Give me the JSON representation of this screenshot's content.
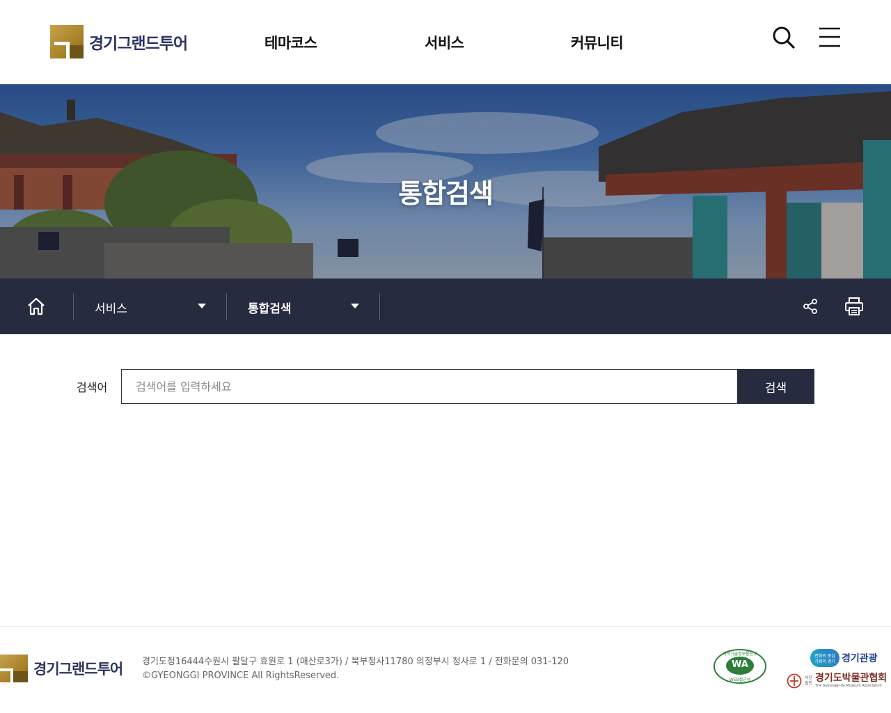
{
  "header": {
    "logo_text": "경기그랜드투어",
    "nav": [
      "테마코스",
      "서비스",
      "커뮤니티"
    ]
  },
  "banner": {
    "title": "통합검색"
  },
  "breadcrumb": {
    "level1": "서비스",
    "level2": "통합검색"
  },
  "search": {
    "label": "검색어",
    "placeholder": "검색어를 입력하세요",
    "button_label": "검색"
  },
  "footer": {
    "logo_text": "경기그랜드투어",
    "address": "경기도청16444수원시 팔달구 효원로 1 (매산로3가) / 북부청사11780 의정부시 청사로 1 / 전화문의 031-120",
    "copyright": "©GYEONGGI PROVINCE All RightsReserved.",
    "wa_top": "과학기술정보통신부",
    "wa_mark": "WA",
    "wa_caption": "WEB접근성",
    "partner1_sub1": "변화의 중심",
    "partner1_sub2": "기회의 경기",
    "partner1_name": "경기관광",
    "partner2_prefix1": "사단",
    "partner2_prefix2": "법인",
    "partner2_name": "경기도박물관협회",
    "partner2_en": "The Gyeonggi-do Museum Association"
  },
  "colors": {
    "navy": "#272b3f",
    "gold": "#b08a30",
    "logo_text": "#2c3561"
  }
}
